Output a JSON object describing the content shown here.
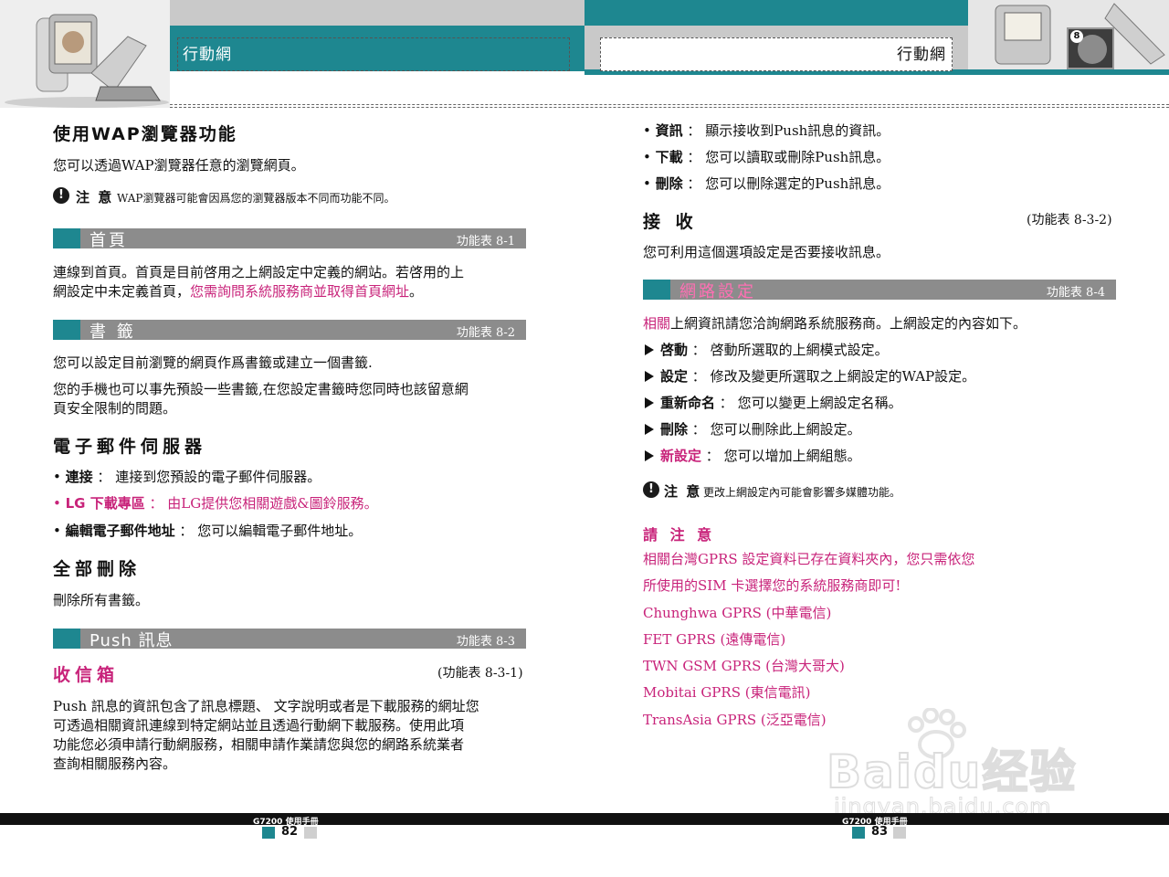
{
  "header": {
    "left_title": "行動網",
    "right_title": "行動網",
    "badge": "8"
  },
  "left": {
    "wap_heading": "使用WAP瀏覽器功能",
    "wap_desc": "您可以透過WAP瀏覽器任意的瀏覽網頁。",
    "note1_label": "注 意",
    "note1_text": "WAP瀏覽器可能會因爲您的瀏覽器版本不同而功能不同。",
    "home": {
      "label": "首頁",
      "ref": "功能表   8-1",
      "text1": "連線到首頁。首頁是目前啓用之上網設定中定義的網站。若啓用的上",
      "text2a": "網設定中未定義首頁，",
      "text2b": "您需詢問系統服務商並取得首頁網址",
      "text2c": "。"
    },
    "bookmark": {
      "label": "書 籤",
      "ref": "功能表   8-2",
      "text1": "您可以設定目前瀏覽的網頁作爲書籤或建立一個書籤.",
      "text2": "您的手機也可以事先預設一些書籤,在您設定書籤時您同時也該留意網",
      "text3": "頁安全限制的問題。"
    },
    "email": {
      "heading": "電子郵件伺服器",
      "items": [
        {
          "label": "連接",
          "text": "：  連接到您預設的電子郵件伺服器。"
        },
        {
          "label": "LG  下載專區",
          "text": "：  由LG提供您相關遊戲&圖鈴服務。"
        },
        {
          "label": "編輯電子郵件地址",
          "text": "：  您可以編輯電子郵件地址。"
        }
      ]
    },
    "delete_all": {
      "heading": "全部刪除",
      "text": "刪除所有書籤。"
    },
    "push": {
      "label": "Push   訊息",
      "ref": "功能表   8-3"
    },
    "inbox": {
      "heading": "收信箱",
      "ref": "(功能表 8-3-1)",
      "lines": [
        "Push  訊息的資訊包含了訊息標題、 文字說明或者是下載服務的網址您",
        "可透過相關資訊連線到特定網站並且透過行動網下載服務。使用此項",
        "功能您必須申請行動網服務，相關申請作業請您與您的網路系統業者",
        "查詢相關服務內容。"
      ]
    }
  },
  "right": {
    "push_items": [
      {
        "label": "資訊",
        "text": "：  顯示接收到Push訊息的資訊。"
      },
      {
        "label": "下載",
        "text": "：  您可以讀取或刪除Push訊息。"
      },
      {
        "label": "刪除",
        "text": "：  您可以刪除選定的Push訊息。"
      }
    ],
    "receive": {
      "heading": "接 收",
      "ref": "(功能表 8-3-2)",
      "text": "您可利用這個選項設定是否要接收訊息。"
    },
    "network": {
      "label": "網路設定",
      "ref": "功能表   8-4",
      "intro_a": "相關",
      "intro_b": "上網資訊請您洽詢網路系統服務商。上網設定的內容如下。",
      "items": [
        {
          "label": "啓動",
          "text": "：  啓動所選取的上網模式設定。"
        },
        {
          "label": "設定",
          "text": "：  修改及變更所選取之上網設定的WAP設定。"
        },
        {
          "label": "重新命名",
          "text": "：  您可以變更上網設定名稱。"
        },
        {
          "label": "刪除",
          "text": "：  您可以刪除此上網設定。"
        },
        {
          "label": "新設定",
          "text": "：  您可以增加上網組態。"
        }
      ]
    },
    "note2_label": "注 意",
    "note2_text": "更改上網設定內可能會影響多媒體功能。",
    "attention": {
      "heading": "請 注 意",
      "lines": [
        "相關台灣GPRS  設定資料已存在資料夾內，您只需依您",
        "所使用的SIM  卡選擇您的系統服務商即可!",
        "Chunghwa  GPRS  (中華電信)",
        "FET  GPRS  (遠傳電信)",
        "TWN  GSM  GPRS  (台灣大哥大)",
        "Mobitai  GPRS  (東信電訊)",
        "TransAsia  GPRS  (泛亞電信)"
      ]
    }
  },
  "footer": {
    "left_label": "G7200  使用手冊",
    "left_page": "82",
    "right_label": "G7200  使用手冊",
    "right_page": "83"
  },
  "watermark": {
    "text": "Baidu经验",
    "url": "jingyan.baidu.com"
  },
  "colors": {
    "teal": "#1e8790",
    "pink": "#c8237a",
    "bar_grey": "#8c8c8c"
  }
}
